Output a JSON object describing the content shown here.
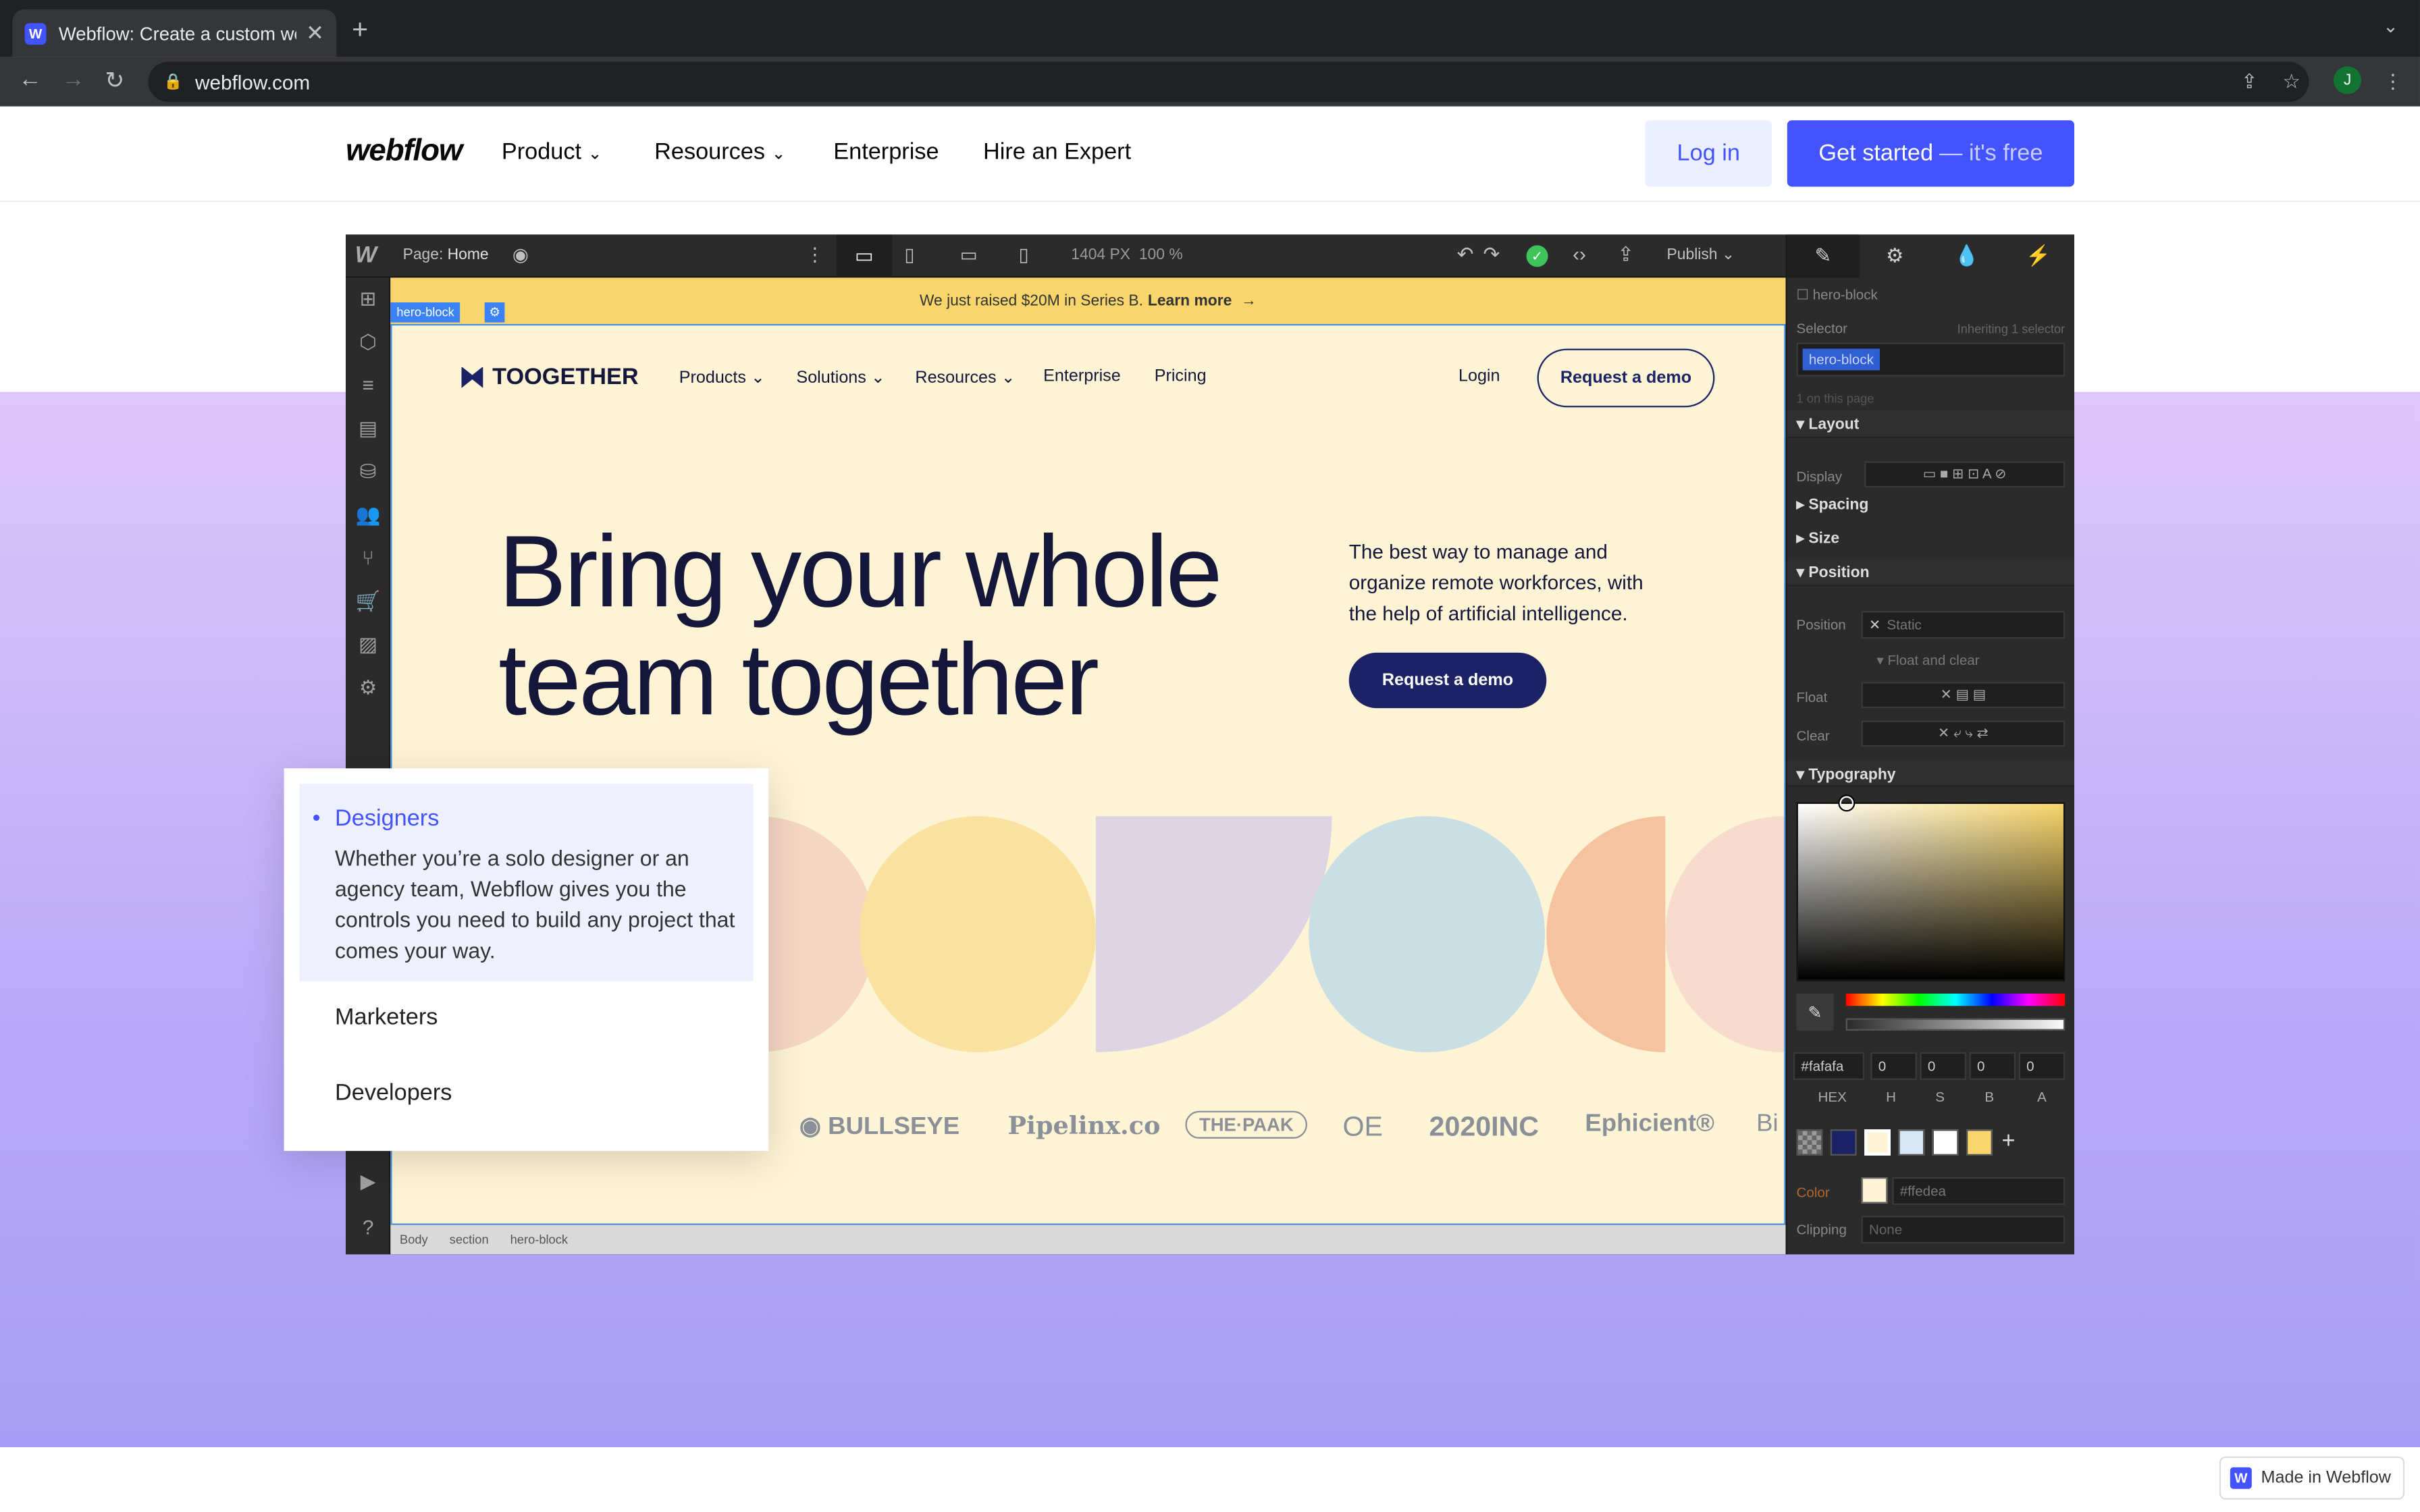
{
  "browser": {
    "tab_title": "Webflow: Create a custom website",
    "tab_close": "✕",
    "new_tab": "+",
    "url": "webflow.com",
    "profile_initial": "J"
  },
  "site_nav": {
    "logo": "webflow",
    "links": [
      "Product",
      "Resources",
      "Enterprise",
      "Hire an Expert"
    ],
    "login": "Log in",
    "get_started": "Get started",
    "get_started_suffix": "— it's free"
  },
  "designer": {
    "page_label": "Page:",
    "page_name": "Home",
    "width_px": "1404 PX",
    "zoom": "100 %",
    "publish": "Publish",
    "selected_tag": "hero-block",
    "breadcrumb": [
      "Body",
      "section",
      "hero-block"
    ],
    "canvas": {
      "banner_text": "We just raised $20M in Series B.",
      "banner_link": "Learn more",
      "banner_arrow": "→",
      "brand": "TOOGETHER",
      "nav": [
        "Products",
        "Solutions",
        "Resources",
        "Enterprise",
        "Pricing"
      ],
      "login": "Login",
      "request_demo_nav": "Request a demo",
      "headline_line1": "Bring your whole",
      "headline_line2": "team together",
      "subtext": "The best way to manage and organize remote workforces, with the help of artificial intelligence.",
      "request_demo_cta": "Request a demo",
      "logos": [
        "BULLSEYE",
        "Pipelinx.co",
        "THE·PAAK",
        "OE",
        "2020INC",
        "Ephicient®",
        "Bi"
      ]
    },
    "style_panel": {
      "element_name": "hero-block",
      "selector_label": "Selector",
      "inheriting": "Inheriting 1 selector",
      "selector_chip": "hero-block",
      "on_page": "1 on this page",
      "sections": {
        "layout": "Layout",
        "display": "Display",
        "spacing": "Spacing",
        "size": "Size",
        "position": "Position",
        "position_label": "Position",
        "position_value": "Static",
        "float_clear": "Float and clear",
        "float": "Float",
        "clear": "Clear",
        "typography": "Typography"
      },
      "color_inputs": {
        "hex": "#fafafa",
        "h": "0",
        "s": "0",
        "b": "0",
        "a": "0"
      },
      "color_labels": {
        "hex": "HEX",
        "h": "H",
        "s": "S",
        "b": "B",
        "a": "A"
      },
      "color_label": "Color",
      "color_value": "#ffedea",
      "clipping_label": "Clipping",
      "clipping_value": "None",
      "swatches": [
        "#cccccc",
        "#1c2266",
        "#fdf3d5",
        "#d8e7f5",
        "#ffffff",
        "#f8d66b"
      ]
    }
  },
  "popup": {
    "items": [
      {
        "title": "Designers",
        "desc": "Whether you’re a solo designer or an agency team, Webflow gives you the controls you need to build any project that comes your way."
      },
      {
        "title": "Marketers"
      },
      {
        "title": "Developers"
      }
    ]
  },
  "badge": "Made in Webflow"
}
